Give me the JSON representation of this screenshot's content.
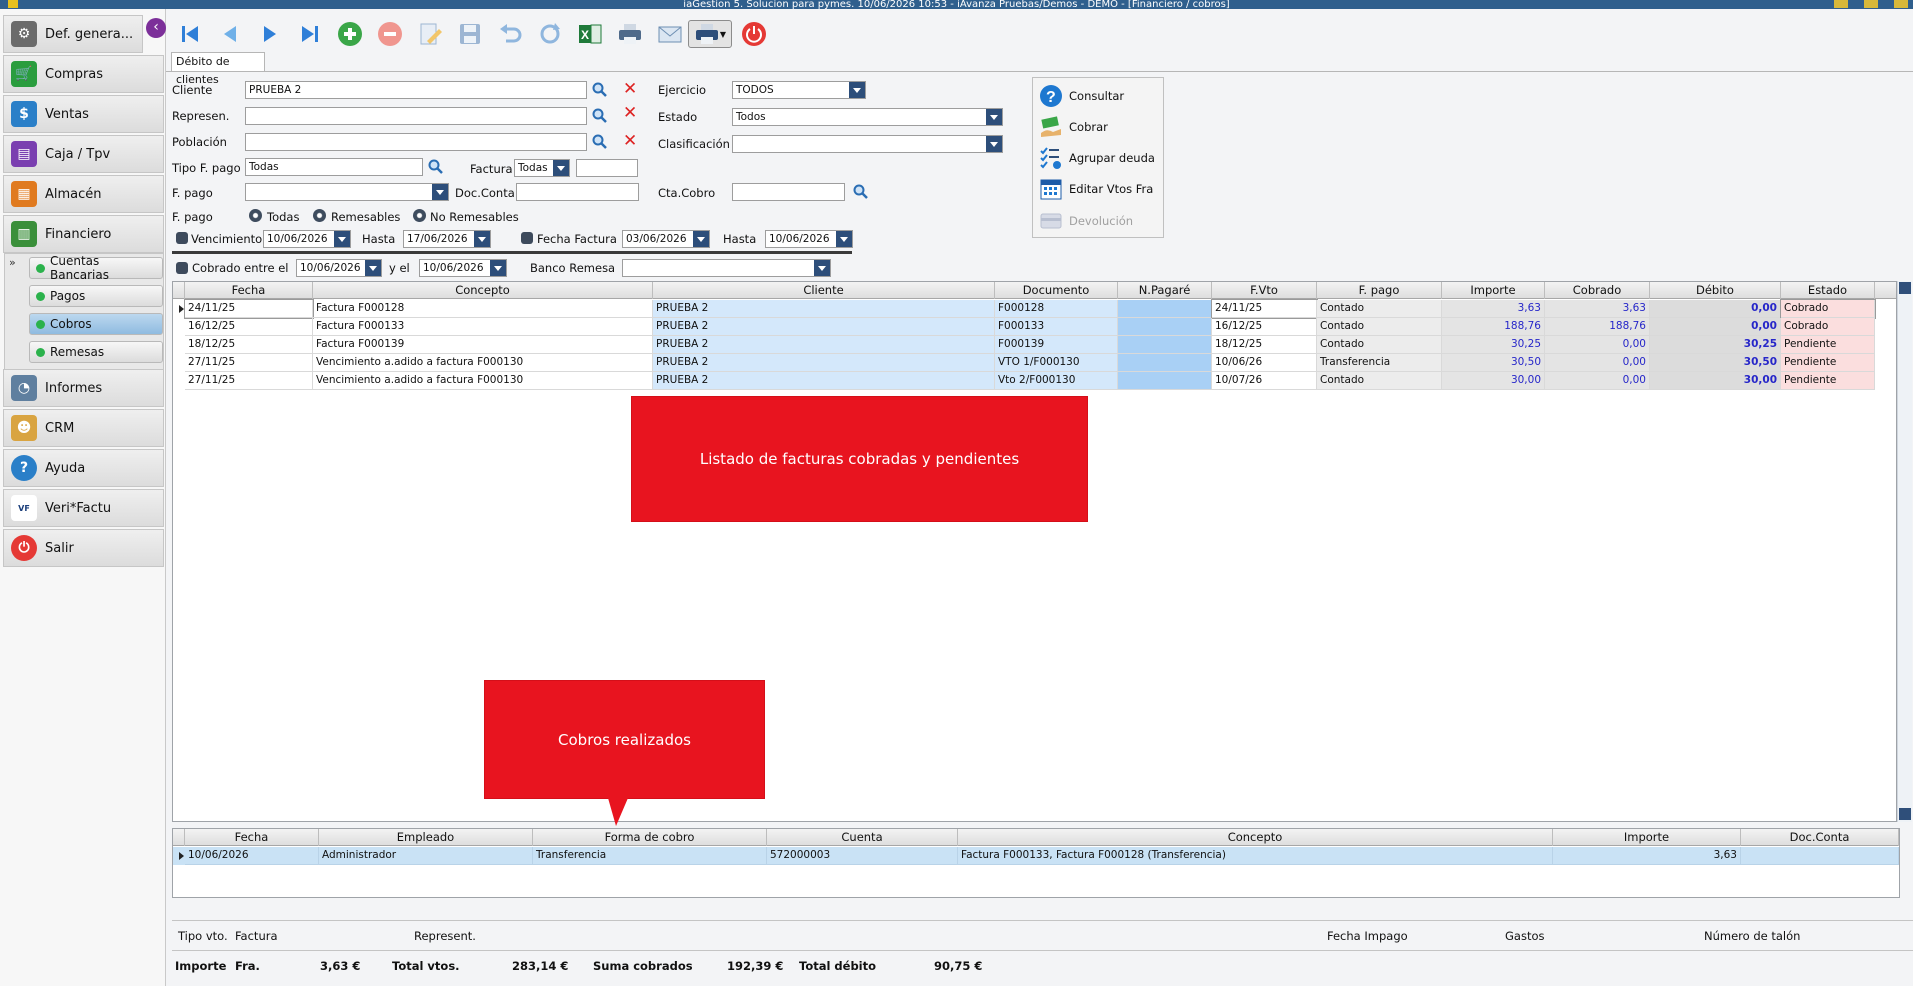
{
  "window": {
    "title": "iaGestion 5. Solucion para pymes.   10/06/2026 10:53   -  iAvanza Pruebas/Demos - DEMO - [Financiero / cobros]"
  },
  "sidebar": {
    "items": [
      {
        "label": "Def. genera...",
        "icon": "gear-icon",
        "color": "#6b6b6b"
      },
      {
        "label": "Compras",
        "icon": "cart-icon",
        "color": "#2a9d3e"
      },
      {
        "label": "Ventas",
        "icon": "sales-icon",
        "color": "#2a7fc8"
      },
      {
        "label": "Caja / Tpv",
        "icon": "cash-register-icon",
        "color": "#7a3fb0"
      },
      {
        "label": "Almacén",
        "icon": "warehouse-icon",
        "color": "#e07a1f"
      },
      {
        "label": "Financiero",
        "icon": "finance-icon",
        "color": "#3a8f3a"
      },
      {
        "label": "Informes",
        "icon": "report-icon",
        "color": "#5f7f9f"
      },
      {
        "label": "CRM",
        "icon": "crm-icon",
        "color": "#d9a441"
      },
      {
        "label": "Ayuda",
        "icon": "help-icon",
        "color": "#2a7fc8"
      },
      {
        "label": "Veri*Factu",
        "icon": "verifactu-icon",
        "color": "#ffffff"
      },
      {
        "label": "Salir",
        "icon": "power-icon",
        "color": "#e53935"
      }
    ],
    "submenu": [
      {
        "label": "Cuentas Bancarias"
      },
      {
        "label": "Pagos"
      },
      {
        "label": "Cobros"
      },
      {
        "label": "Remesas"
      }
    ]
  },
  "tab": {
    "label": "Débito de clientes"
  },
  "filters": {
    "cliente_label": "Cliente",
    "cliente_value": "PRUEBA 2",
    "represen_label": "Represen.",
    "represen_value": "",
    "poblacion_label": "Población",
    "poblacion_value": "",
    "tipofpago_label": "Tipo F. pago",
    "tipofpago_value": "Todas",
    "factura_label": "Factura",
    "factura_value": "Todas",
    "factura_num": "",
    "fpago_label": "F. pago",
    "fpago_value": "",
    "docconta_label": "Doc.Conta",
    "docconta_value": "",
    "ejercicio_label": "Ejercicio",
    "ejercicio_value": "TODOS",
    "estado_label": "Estado",
    "estado_value": "Todos",
    "clasificacion_label": "Clasificación",
    "clasificacion_value": "",
    "ctacobro_label": "Cta.Cobro",
    "ctacobro_value": "",
    "fpago_radio_label": "F. pago",
    "radio_todas": "Todas",
    "radio_remesables": "Remesables",
    "radio_noremesables": "No Remesables",
    "vencimiento_label": "Vencimiento",
    "vencimiento_from": "10/06/2026",
    "hasta_label": "Hasta",
    "vencimiento_to": "17/06/2026",
    "fechafactura_label": "Fecha Factura",
    "fechafactura_from": "03/06/2026",
    "hasta2_label": "Hasta",
    "fechafactura_to": "10/06/2026",
    "cobrado_label": "Cobrado entre el",
    "cobrado_from": "10/06/2026",
    "yel_label": "y el",
    "cobrado_to": "10/06/2026",
    "bancoremesa_label": "Banco Remesa",
    "bancoremesa_value": ""
  },
  "actions": [
    {
      "label": "Consultar",
      "icon": "help-circle-icon"
    },
    {
      "label": "Cobrar",
      "icon": "money-hand-icon"
    },
    {
      "label": "Agrupar deuda",
      "icon": "checklist-icon"
    },
    {
      "label": "Editar Vtos Fra",
      "icon": "calendar-icon"
    },
    {
      "label": "Devolución",
      "icon": "return-icon"
    }
  ],
  "invoices": {
    "headers": [
      "Fecha",
      "Concepto",
      "Cliente",
      "Documento",
      "N.Pagaré",
      "F.Vto",
      "F. pago",
      "Importe",
      "Cobrado",
      "Débito",
      "Estado"
    ],
    "rows": [
      {
        "fecha": "24/11/25",
        "concepto": "Factura F000128",
        "cliente": "PRUEBA 2",
        "documento": "F000128",
        "npagare": "",
        "fvto": "24/11/25",
        "fpago": "Contado",
        "importe": "3,63",
        "cobrado": "3,63",
        "debito": "0,00",
        "estado": "Cobrado"
      },
      {
        "fecha": "16/12/25",
        "concepto": "Factura F000133",
        "cliente": "PRUEBA 2",
        "documento": "F000133",
        "npagare": "",
        "fvto": "16/12/25",
        "fpago": "Contado",
        "importe": "188,76",
        "cobrado": "188,76",
        "debito": "0,00",
        "estado": "Cobrado"
      },
      {
        "fecha": "18/12/25",
        "concepto": "Factura F000139",
        "cliente": "PRUEBA 2",
        "documento": "F000139",
        "npagare": "",
        "fvto": "18/12/25",
        "fpago": "Contado",
        "importe": "30,25",
        "cobrado": "0,00",
        "debito": "30,25",
        "estado": "Pendiente"
      },
      {
        "fecha": "27/11/25",
        "concepto": "Vencimiento a.adido a factura F000130",
        "cliente": "PRUEBA 2",
        "documento": "VTO 1/F000130",
        "npagare": "",
        "fvto": "10/06/26",
        "fpago": "Transferencia",
        "importe": "30,50",
        "cobrado": "0,00",
        "debito": "30,50",
        "estado": "Pendiente"
      },
      {
        "fecha": "27/11/25",
        "concepto": "Vencimiento a.adido a factura F000130",
        "cliente": "PRUEBA 2",
        "documento": "Vto 2/F000130",
        "npagare": "",
        "fvto": "10/07/26",
        "fpago": "Contado",
        "importe": "30,00",
        "cobrado": "0,00",
        "debito": "30,00",
        "estado": "Pendiente"
      }
    ]
  },
  "callouts": {
    "invoices": "Listado de facturas cobradas y pendientes",
    "payments": "Cobros realizados"
  },
  "payments": {
    "headers": [
      "Fecha",
      "Empleado",
      "Forma de cobro",
      "Cuenta",
      "Concepto",
      "Importe",
      "Doc.Conta"
    ],
    "rows": [
      {
        "fecha": "10/06/2026",
        "empleado": "Administrador",
        "forma": "Transferencia",
        "cuenta": "572000003",
        "concepto": "Factura F000133, Factura F000128 (Transferencia)",
        "importe": "3,63",
        "docconta": ""
      }
    ]
  },
  "detail": {
    "tipovto": "Tipo vto.",
    "factura": "Factura",
    "represent": "Represent.",
    "fechaimpago": "Fecha Impago",
    "gastos": "Gastos",
    "numtalon": "Número de talón"
  },
  "totals": {
    "importe_label": "Importe",
    "fra_label": "Fra.",
    "fra_value": "3,63 €",
    "totalvtos_label": "Total vtos.",
    "totalvtos_value": "283,14 €",
    "sumacobrados_label": "Suma cobrados",
    "sumacobrados_value": "192,39 €",
    "totaldebito_label": "Total débito",
    "totaldebito_value": "90,75 €"
  },
  "colors": {
    "accent": "#2f5f8d",
    "callout": "#e8141f",
    "cliente_cell": "#d4e8fb",
    "pagare_cell": "#a9d0f5",
    "estado_cell": "#fbdede",
    "selected_row": "#c9e2f5"
  }
}
